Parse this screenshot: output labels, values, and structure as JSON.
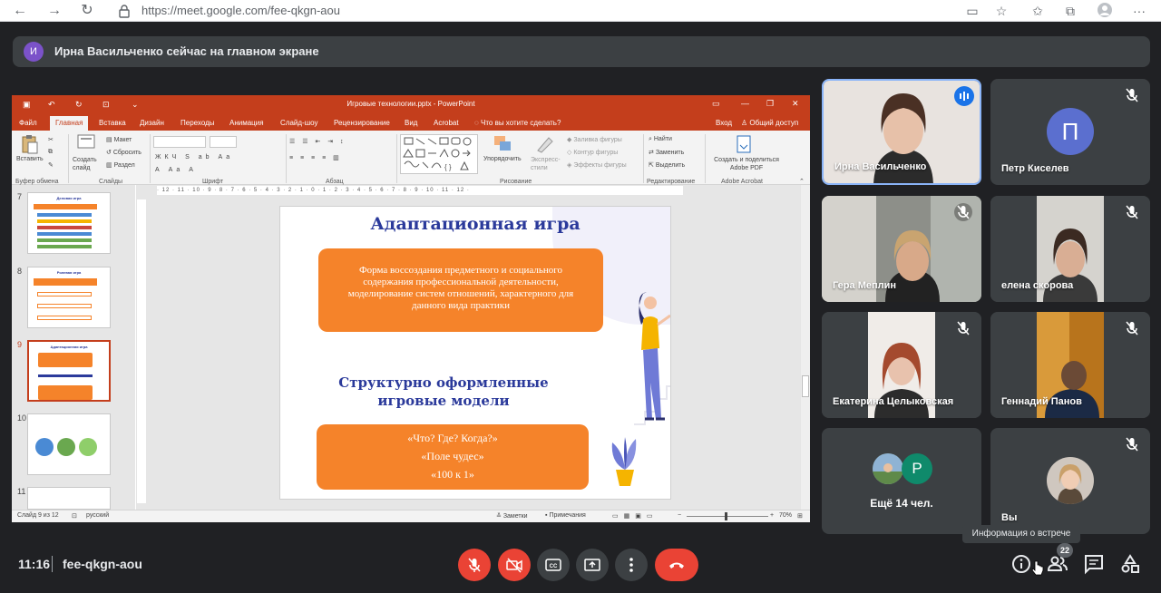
{
  "browser": {
    "url": "https://meet.google.com/fee-qkgn-aou"
  },
  "banner": {
    "avatar_letter": "И",
    "text": "Ирна Васильченко сейчас на главном экране"
  },
  "ppt": {
    "title": "Игровые технологии.pptx - PowerPoint",
    "tabs": [
      "Файл",
      "Главная",
      "Вставка",
      "Дизайн",
      "Переходы",
      "Анимация",
      "Слайд-шоу",
      "Рецензирование",
      "Вид",
      "Acrobat",
      "Что вы хотите сделать?"
    ],
    "login": "Вход",
    "share": "Общий доступ",
    "ribbon": {
      "paste": "Вставить",
      "create_slide": "Создать слайд",
      "layout": "Макет",
      "reset": "Сбросить",
      "section": "Раздел",
      "arrange": "Упорядочить",
      "quick_styles": "Экспресс-стили",
      "fill": "Заливка фигуры",
      "outline": "Контур фигуры",
      "effects": "Эффекты фигуры",
      "find": "Найти",
      "replace": "Заменить",
      "select": "Выделить",
      "create_pdf": "Создать и поделиться Adobe PDF",
      "groups": [
        "Буфер обмена",
        "Слайды",
        "Шрифт",
        "Абзац",
        "Рисование",
        "Редактирование",
        "Adobe Acrobat"
      ]
    },
    "thumbnails": [
      {
        "num": "7",
        "title": "Деловая игра"
      },
      {
        "num": "8",
        "title": "Ролевая игра"
      },
      {
        "num": "9",
        "title": "Адаптационная игра"
      },
      {
        "num": "10",
        "title": ""
      },
      {
        "num": "11",
        "title": ""
      }
    ],
    "slide": {
      "title": "Адаптационная игра",
      "box1": "Форма воссоздания предметного и социального содержания профессиональной деятельности, моделирование систем отношений, характерного для данного вида практики",
      "subtitle": "Структурно оформленные игровые модели",
      "items": [
        "«Что? Где? Когда?»",
        "«Поле чудес»",
        "«100 к 1»"
      ]
    },
    "status": {
      "slide": "Слайд 9 из 12",
      "lang": "русский",
      "notes": "Заметки",
      "comments": "Примечания",
      "zoom": "70%"
    },
    "ruler_h": "· 12 · 11 · 10 · 9 · 8 · 7 · 6 · 5 · 4 · 3 · 2 · 1 · 0 · 1 · 2 · 3 · 4 · 5 · 6 · 7 · 8 · 9 · 10 · 11 · 12 ·"
  },
  "participants": [
    {
      "name": "Ирна Васильченко",
      "speaking": true
    },
    {
      "name": "Петр Киселев",
      "letter": "П"
    },
    {
      "name": "Гера Меплин"
    },
    {
      "name": "елена скорова"
    },
    {
      "name": "Екатерина Целыковская"
    },
    {
      "name": "Геннадий Панов"
    },
    {
      "name": "Ещё 14 чел.",
      "letter": "Р"
    },
    {
      "name": "Вы"
    }
  ],
  "bottom": {
    "time": "11:16",
    "code": "fee-qkgn-aou",
    "tooltip": "Информация о встрече",
    "people_count": "22"
  },
  "colors": {
    "accent_red": "#ea4335",
    "ppt_red": "#c43e1c",
    "slide_orange": "#f5832a",
    "slide_blue": "#2b3a9b"
  }
}
